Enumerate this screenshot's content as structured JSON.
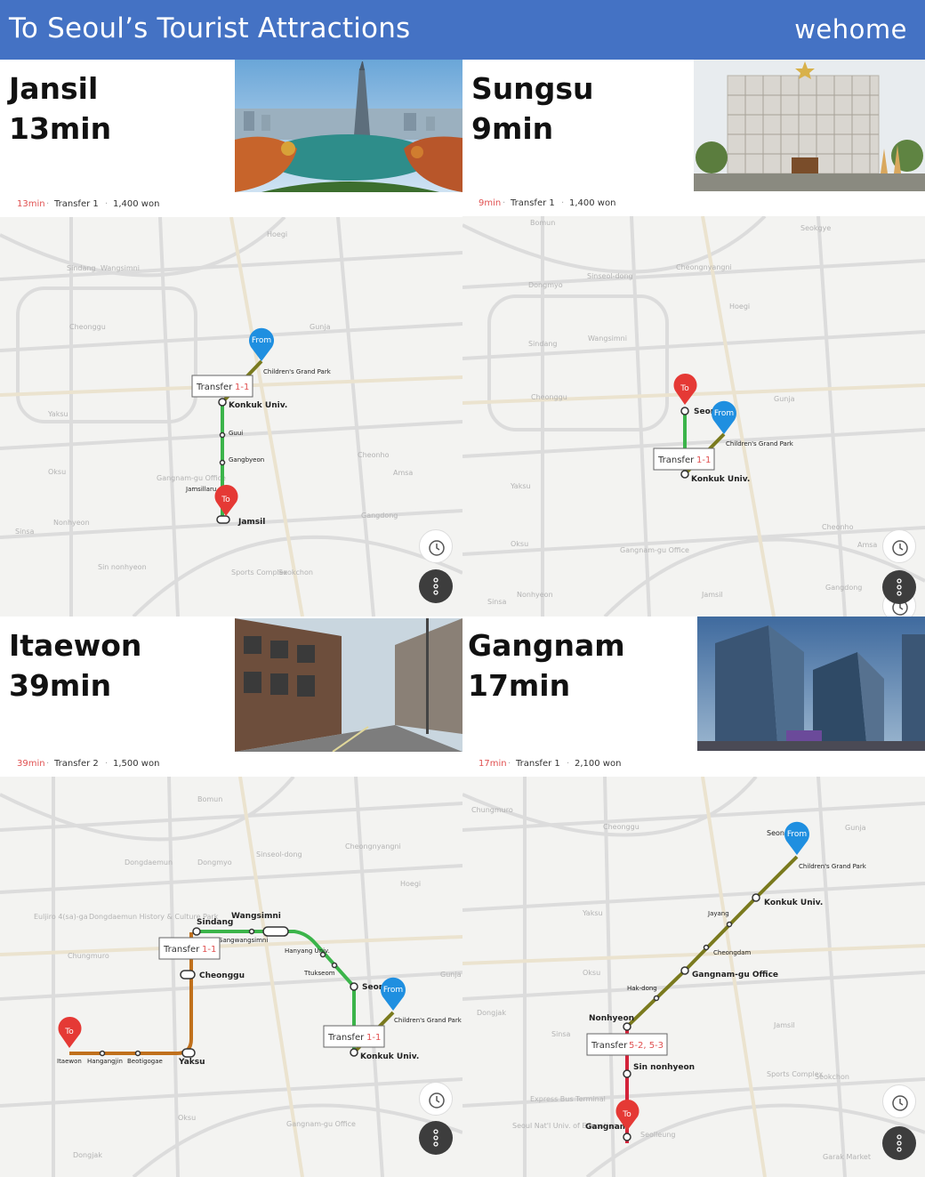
{
  "header": {
    "title": "To Seoul’s Tourist Attractions",
    "logo": "wehome"
  },
  "destinations": [
    {
      "name": "Jansil",
      "time": "13min",
      "route": {
        "time": "13min",
        "transfer": "Transfer 1",
        "fare": "1,400 won"
      },
      "photo": "lotte-tower-lake-photo",
      "map": {
        "transfer_label": "Transfer",
        "transfer_line": "1-1",
        "stations": [
          "Konkuk Univ.",
          "Guui",
          "Gangbyeon",
          "Jamsillaru",
          "Jamsil",
          "Children's Grand Park"
        ],
        "from": "From",
        "to": "To",
        "bg_labels": [
          "Sindang",
          "Wangsimni",
          "Cheonggu",
          "Yaksu",
          "Oksu",
          "Sinsa",
          "Cheonho",
          "Amsa",
          "Gangdong",
          "Seokchon",
          "Sports Complex",
          "Gangnam-gu Office",
          "Nonhyeon",
          "Hoegi",
          "Gunja",
          "Sin nonhyeon"
        ]
      }
    },
    {
      "name": "Sungsu",
      "time": "9min",
      "route": {
        "time": "9min",
        "transfer": "Transfer 1",
        "fare": "1,400 won"
      },
      "photo": "dior-building-photo",
      "map": {
        "transfer_label": "Transfer",
        "transfer_line": "1-1",
        "stations": [
          "Seong",
          "Konkuk Univ.",
          "Children's Grand Park"
        ],
        "from": "From",
        "to": "To",
        "bg_labels": [
          "Bomun",
          "Dongmyo",
          "Sinseol-dong",
          "Cheongnyangni",
          "Seokgye",
          "Sindang",
          "Wangsimni",
          "Cheonggu",
          "Yaksu",
          "Oksu",
          "Nonhyeon",
          "Jamsil",
          "Gangnam-gu Office",
          "Cheonho",
          "Amsa",
          "Gangdong",
          "Sinsa",
          "Hoegi",
          "Gunja"
        ]
      }
    },
    {
      "name": "Itaewon",
      "time": "39min",
      "route": {
        "time": "39min",
        "transfer": "Transfer 2",
        "fare": "1,500 won"
      },
      "photo": "itaewon-street-photo",
      "map": {
        "transfer_label": "Transfer",
        "transfer_line": "1-1",
        "stations": [
          "Sindang",
          "Wangsimni",
          "Sangwangsimni",
          "Cheonggu",
          "Hanyang Univ.",
          "Ttukseom",
          "Seong",
          "Konkuk Univ.",
          "Children's Grand Park",
          "Itaewon",
          "Hangangjin",
          "Beotigogae",
          "Yaksu"
        ],
        "from": "From",
        "to": "To",
        "bg_labels": [
          "Bomun",
          "Dongdaemun",
          "Dongmyo",
          "Sinseol-dong",
          "Cheongnyangni",
          "Hoegi",
          "Dongdaemun History & Culture Park",
          "Euljiro 4(sa)-ga",
          "Chungmuro",
          "Oksu",
          "Gangnam-gu Office",
          "Dongjak",
          "Gunja"
        ]
      }
    },
    {
      "name": "Gangnam",
      "time": "17min",
      "route": {
        "time": "17min",
        "transfer": "Transfer 1",
        "fare": "2,100 won"
      },
      "photo": "gangnam-towers-photo",
      "map": {
        "transfer_label": "Transfer",
        "transfer_line": "5-2, 5-3",
        "stations": [
          "Konkuk Univ.",
          "Jayang",
          "Cheongdam",
          "Gangnam-gu Office",
          "Hak-dong",
          "Nonhyeon",
          "Sin nonhyeon",
          "Gangnam",
          "Children's Grand Park",
          "Seon"
        ],
        "from": "From",
        "to": "To",
        "bg_labels": [
          "Chungmuro",
          "Cheonggu",
          "Yaksu",
          "Oksu",
          "Sinsa",
          "Dongjak",
          "Jamsil",
          "Sports Complex",
          "Seokchon",
          "Garak Market",
          "Gunja",
          "Seolleung",
          "Seoul Nat'l Univ. of Education",
          "Express Bus Terminal"
        ]
      }
    }
  ],
  "colors": {
    "header": "#4472c4",
    "line2": "#3bb44a",
    "line7": "#7a7a1e",
    "line6": "#c0701c",
    "sinbundang": "#d4233a",
    "from_pin": "#1f8fe0",
    "to_pin": "#e53935"
  }
}
